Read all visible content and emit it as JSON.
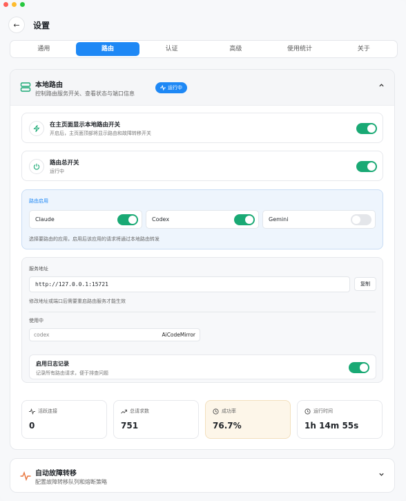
{
  "header": {
    "back_glyph": "←",
    "title": "设置"
  },
  "tabs": [
    {
      "label": "通用"
    },
    {
      "label": "路由",
      "active": true
    },
    {
      "label": "认证"
    },
    {
      "label": "高级"
    },
    {
      "label": "使用统计"
    },
    {
      "label": "关于"
    }
  ],
  "local_routing": {
    "title": "本地路由",
    "subtitle": "控制路由服务开关、查看状态与端口信息",
    "status_badge": "运行中",
    "show_on_home": {
      "title": "在主页面显示本地路由开关",
      "subtitle": "开启后，主页面顶部将显示路由和故障转移开关",
      "enabled": true
    },
    "master_switch": {
      "title": "路由总开关",
      "subtitle": "运行中",
      "enabled": true
    },
    "apps": {
      "title": "路由启用",
      "items": [
        {
          "name": "Claude",
          "enabled": true
        },
        {
          "name": "Codex",
          "enabled": true
        },
        {
          "name": "Gemini",
          "enabled": false
        }
      ],
      "note": "选择要路由的应用，启用后该应用的请求将通过本地路由转发"
    },
    "service": {
      "address_label": "服务地址",
      "address": "http://127.0.0.1:15721",
      "copy_label": "复制",
      "note": "修改地址或端口后需要重启路由服务才能生效",
      "in_use_label": "使用中",
      "in_use_app": "codex",
      "in_use_provider": "AiCodeMirror",
      "logging": {
        "title": "启用日志记录",
        "subtitle": "记录所有路由请求，便于排查问题",
        "enabled": true
      }
    },
    "stats": [
      {
        "label": "活跃连接",
        "value": "0",
        "icon": "activity-icon"
      },
      {
        "label": "总请求数",
        "value": "751",
        "icon": "trending-up-icon"
      },
      {
        "label": "成功率",
        "value": "76.7%",
        "icon": "clock-icon"
      },
      {
        "label": "运行时间",
        "value": "1h 14m 55s",
        "icon": "clock-icon"
      }
    ]
  },
  "failover": {
    "title": "自动故障转移",
    "subtitle": "配置故障转移队列和熔断策略"
  },
  "colors": {
    "accent": "#1e88f5",
    "toggle_on": "#19a974",
    "failover_icon": "#e8743b"
  }
}
